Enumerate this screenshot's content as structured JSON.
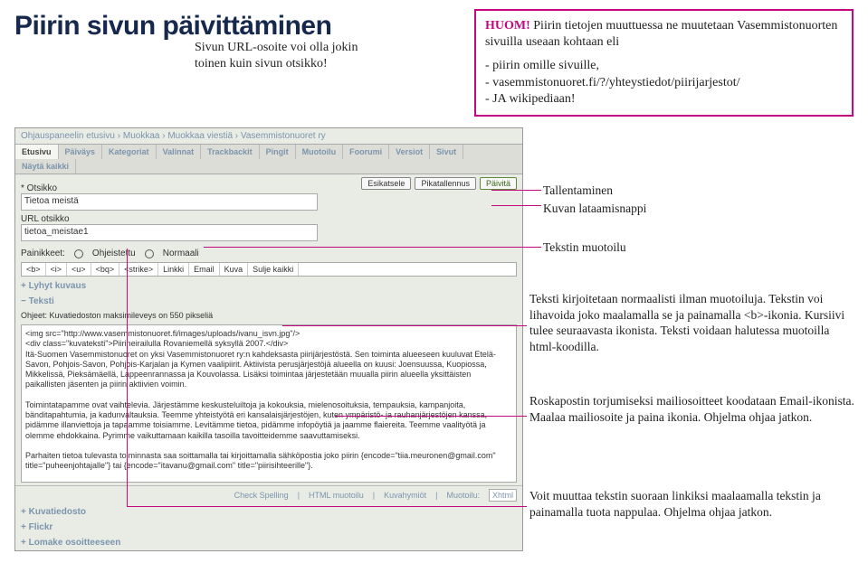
{
  "title": "Piirin sivun päivittäminen",
  "urlNote": "Sivun URL-osoite voi olla jokin toinen kuin sivun otsikko!",
  "topBox": {
    "huom": "HUOM!",
    "line1": " Piirin tietojen muuttuessa ne muutetaan Vasemmistonuorten sivuilla useaan kohtaan eli",
    "b1": "- piirin omille sivuille,",
    "b2": "- vasemmistonuoret.fi/?/yhteystiedot/piirijarjestot/",
    "b3": "- JA wikipediaan!"
  },
  "breadcrumb": {
    "a": "Ohjauspaneelin etusivu",
    "b": "Muokkaa",
    "c": "Muokkaa viestiä",
    "d": "Vasemmistonuoret ry"
  },
  "tabs": [
    "Etusivu",
    "Päiväys",
    "Kategoriat",
    "Valinnat",
    "Trackbackit",
    "Pingit",
    "Muotoilu",
    "Foorumi",
    "Versiot",
    "Sivut",
    "Näytä kaikki"
  ],
  "field": {
    "otsikkoLabel": "* Otsikko",
    "otsikkoValue": "Tietoa meistä",
    "urlLabel": "URL otsikko",
    "urlValue": "tietoa_meistae1"
  },
  "buttons": {
    "esikatsele": "Esikatsele",
    "pikatallennus": "Pikatallennus",
    "paivita": "Päivitä"
  },
  "radio": {
    "label": "Painikkeet:",
    "o1": "Ohjeistettu",
    "o2": "Normaali"
  },
  "toolbar": [
    "<b>",
    "<i>",
    "<u>",
    "<bq>",
    "<strike>",
    "Linkki",
    "Email",
    "Kuva",
    "Sulje kaikki"
  ],
  "panels": {
    "lyhyt": "+ Lyhyt kuvaus",
    "teksti": "− Teksti",
    "kuvatiedosto": "+ Kuvatiedosto",
    "flickr": "+ Flickr",
    "lomake": "+ Lomake osoitteeseen"
  },
  "objLabel": "Ohjeet: Kuvatiedoston maksimileveys on 550 pikseliä",
  "editorText": "<img src=\"http://www.vasemmistonuoret.fi/images/uploads/ivanu_isvn.jpg\"/>\n<div class=\"kuvateksti\">Piirineirailulla Rovaniemellä syksyllä 2007.</div>\nItä-Suomen Vasemmistonuoret on yksi Vasemmistonuoret ry:n kahdeksasta piirijärjestöstä. Sen toiminta alueeseen kuuluvat Etelä-Savon, Pohjois-Savon, Pohjois-Karjalan ja Kymen vaalipiirit. Aktiivista perusjärjestöjä alueella on kuusi: Joensuussa, Kuopiossa, Mikkelissä, Pieksämäellä, Lappeenrannassa ja Kouvolassa. Lisäksi toimintaa järjestetään muualla piirin alueella yksittäisten paikallisten jäsenten ja piirin aktiivien voimin.\n\nToimintatapamme ovat vaihtelevia. Järjestämme keskusteluiltoja ja kokouksia, mielenosoituksia, tempauksia, kampanjoita, bänditapahtumia, ja kadunvaltauksia. Teemme yhteistyötä eri kansalaisjärjestöjen, kuten ympäristö- ja rauhanjärjestöjen kanssa, pidämme illanviettoja ja tapaamme toisiamme. Levitämme tietoa, pidämme infopöytiä ja jaamme flaiereita. Teemme vaalityötä ja olemme ehdokkaina. Pyrimme vaikuttamaan kaikilla tasoilla tavoitteidemme saavuttamiseksi.\n\nParhaiten tietoa tulevasta toiminnasta saa soittamalla tai kirjoittamalla sähköpostia joko piirin {encode=\"tiia.meuronen@gmail.com\" title=\"puheenjohtajalle\"} tai {encode=\"itavanu@gmail.com\" title=\"piirisihteerille\"}.",
  "footer": {
    "spell": "Check Spelling",
    "html": "HTML muotoilu",
    "kuvah": "Kuvahymiöt",
    "muotoilu": "Muotoilu:",
    "sel": "Xhtml"
  },
  "annos": {
    "tallentaminen": "Tallentaminen",
    "kuvan": "Kuvan lataamisnappi",
    "tekstin": "Tekstin muotoilu",
    "teksti1": "Teksti kirjoitetaan normaalisti ilman muotoiluja. Tekstin voi lihavoida joko maalamalla se ja painamalla <b>-ikonia. Kursiivi tulee seuraavasta ikonista. Teksti voidaan halutessa muotoilla html-koodilla.",
    "roska": "Roskapostin torjumiseksi mailiosoitteet koodataan Email-ikonista. Maalaa mailiosoite ja paina ikonia. Ohjelma ohjaa jatkon.",
    "link": "Voit muuttaa tekstin suoraan linkiksi maalaamalla tekstin ja painamalla tuota nappulaa. Ohjelma ohjaa jatkon."
  }
}
